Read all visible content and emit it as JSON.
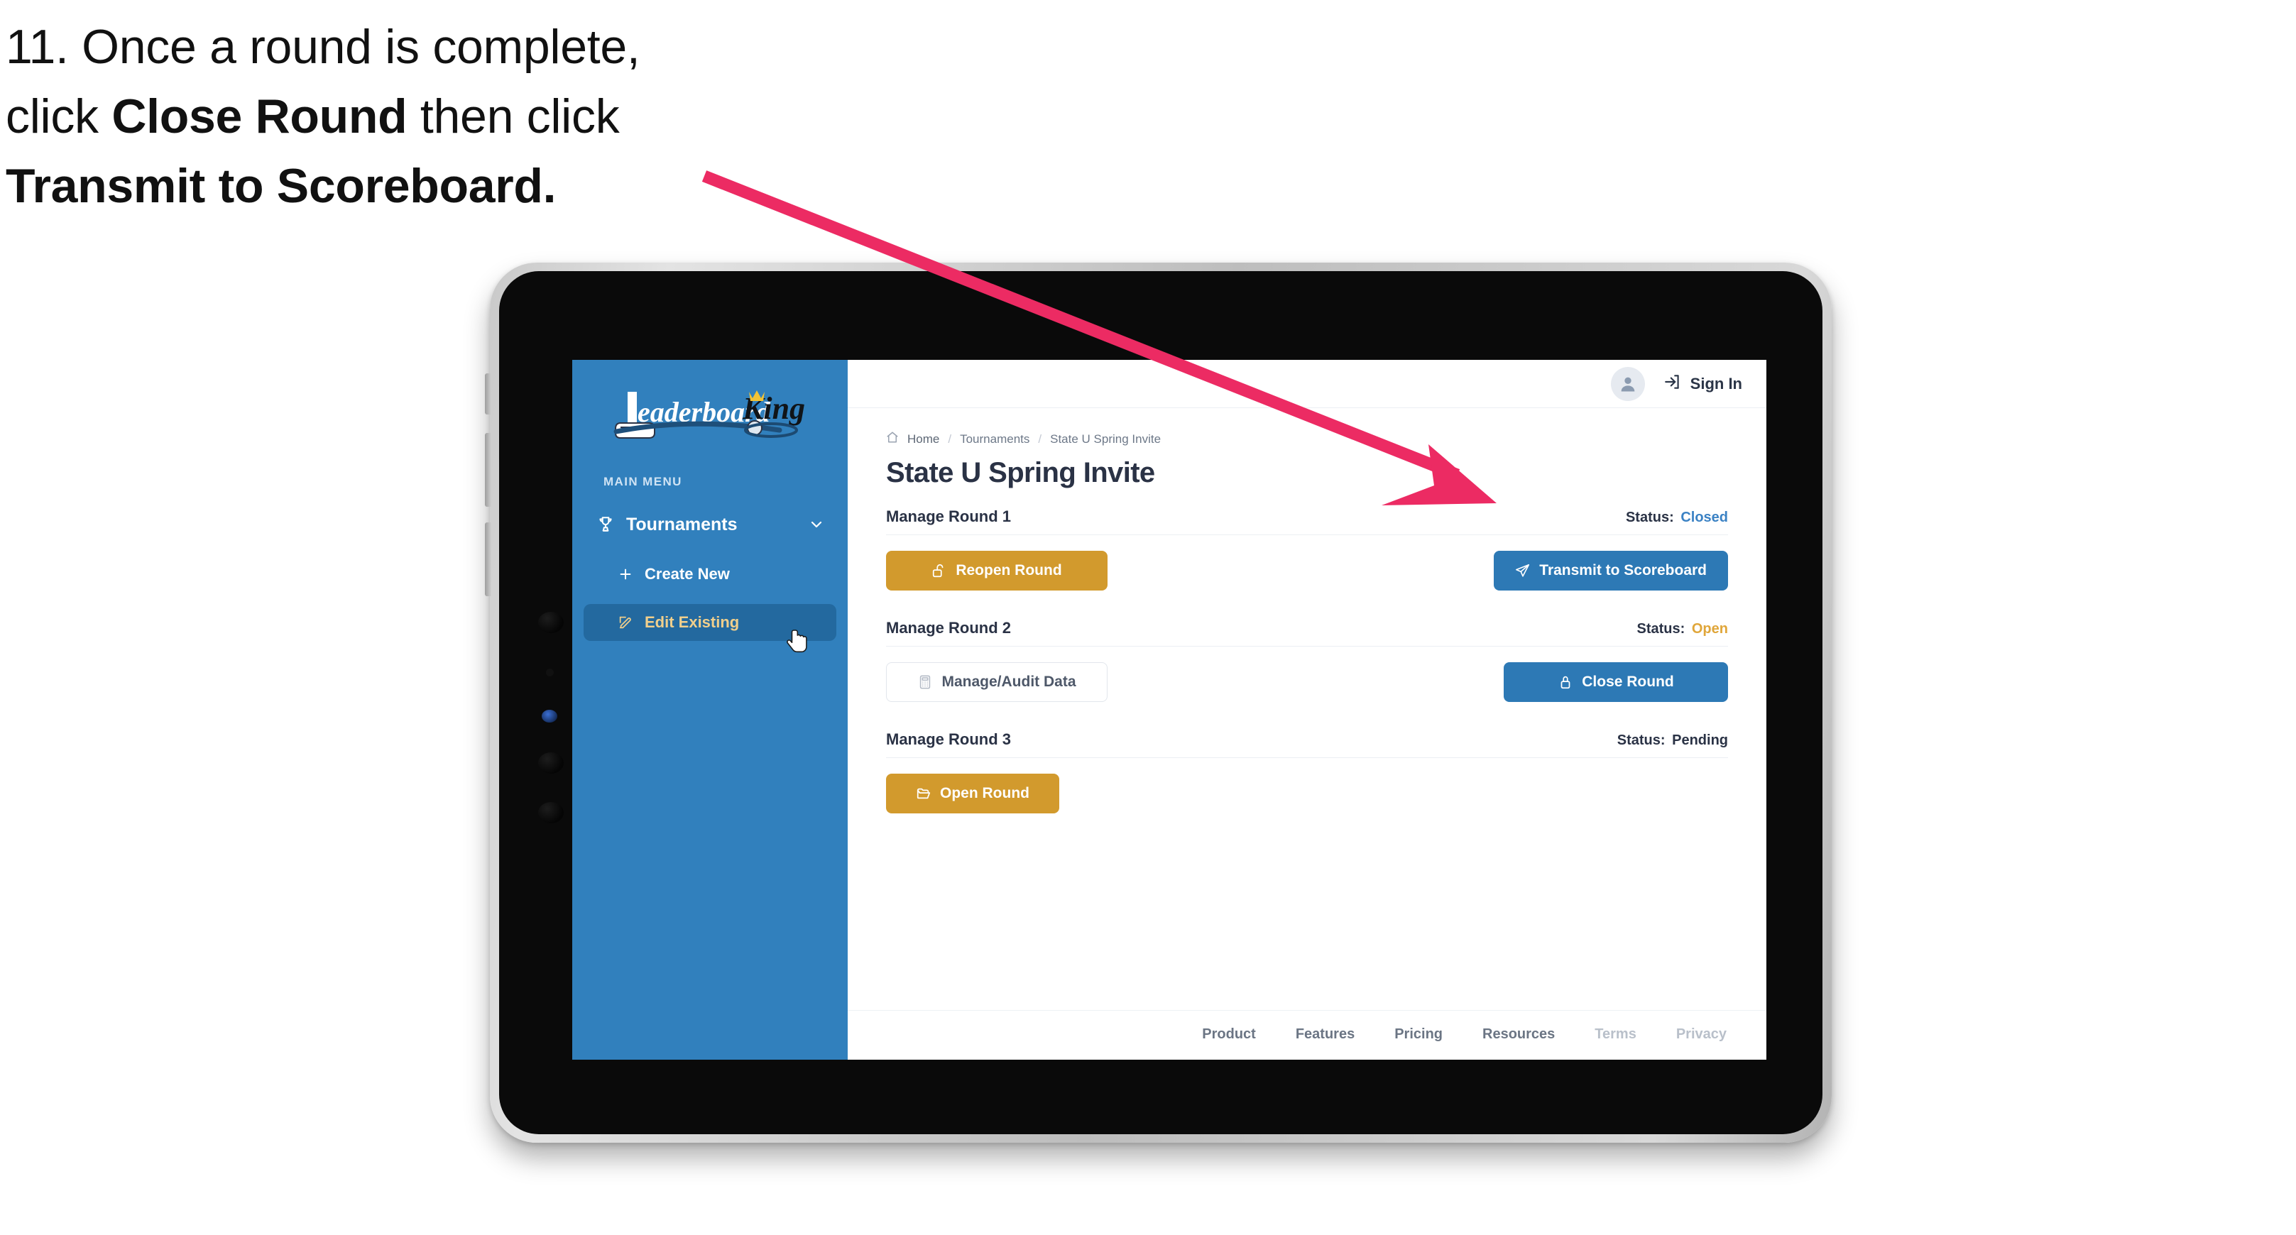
{
  "caption": {
    "step_number": "11.",
    "line1_pre": "11. Once a round is complete,",
    "line2_pre": "click ",
    "line2_bold": "Close Round",
    "line2_post": " then click",
    "line3_bold": "Transmit to Scoreboard."
  },
  "app": {
    "logo_text_main": "Leaderboard",
    "logo_text_accent": "King",
    "sidebar": {
      "section_label": "MAIN MENU",
      "items": [
        {
          "label": "Tournaments",
          "icon": "trophy-icon",
          "chevron": "chevron-down-icon",
          "active": false
        },
        {
          "label": "Create New",
          "icon": "plus-icon",
          "active": false
        },
        {
          "label": "Edit Existing",
          "icon": "pencil-square-icon",
          "active": true
        }
      ]
    },
    "topbar": {
      "avatar_icon": "user-avatar-icon",
      "signin_icon": "sign-in-arrow-icon",
      "signin_label": "Sign In"
    },
    "breadcrumb": {
      "home_icon": "home-icon",
      "items": [
        "Home",
        "Tournaments",
        "State U Spring Invite"
      ],
      "separator": "/"
    },
    "page_title": "State U Spring Invite",
    "rounds": [
      {
        "title": "Manage Round 1",
        "status_label": "Status:",
        "status_value": "Closed",
        "status_color": "#3b82c4",
        "left_button": {
          "label": "Reopen Round",
          "icon": "unlock-icon",
          "style": "gold"
        },
        "right_button": {
          "label": "Transmit to Scoreboard",
          "icon": "paper-plane-icon",
          "style": "blue"
        }
      },
      {
        "title": "Manage Round 2",
        "status_label": "Status:",
        "status_value": "Open",
        "status_color": "#e0a63a",
        "left_button": {
          "label": "Manage/Audit Data",
          "icon": "calculator-icon",
          "style": "ghost"
        },
        "right_button": {
          "label": "Close Round",
          "icon": "lock-icon",
          "style": "blue"
        }
      },
      {
        "title": "Manage Round 3",
        "status_label": "Status:",
        "status_value": "Pending",
        "status_color": "#2a3245",
        "left_button": {
          "label": "Open Round",
          "icon": "folder-open-icon",
          "style": "gold"
        },
        "right_button": null
      }
    ],
    "footer_links": [
      {
        "label": "Product",
        "muted": false
      },
      {
        "label": "Features",
        "muted": false
      },
      {
        "label": "Pricing",
        "muted": false
      },
      {
        "label": "Resources",
        "muted": false
      },
      {
        "label": "Terms",
        "muted": true
      },
      {
        "label": "Privacy",
        "muted": true
      }
    ]
  },
  "colors": {
    "sidebar_blue": "#3180bd",
    "accent_gold": "#d29a2d",
    "primary_blue": "#2d79b5",
    "arrow_pink": "#ec2b63",
    "text_navy": "#2a3245"
  }
}
